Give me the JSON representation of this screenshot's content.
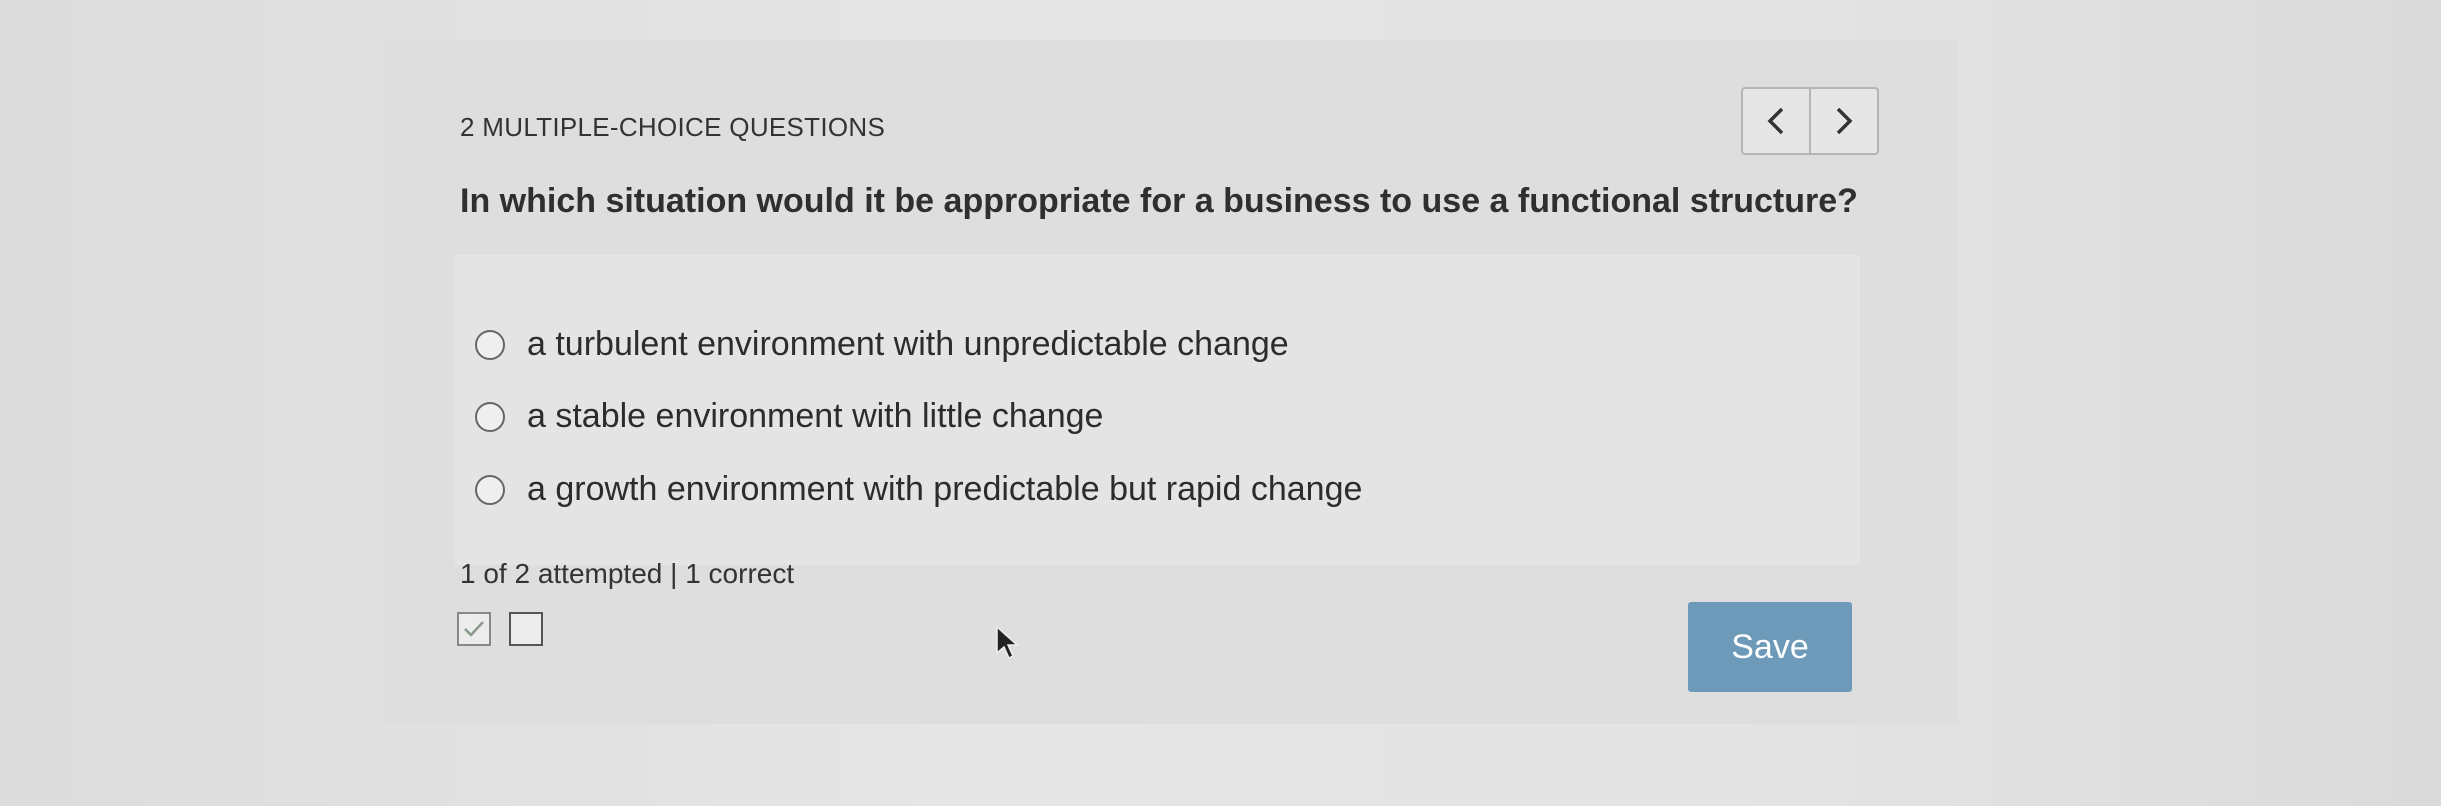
{
  "header": {
    "section_title": "2 MULTIPLE-CHOICE QUESTIONS",
    "prev_icon": "chevron-left-icon",
    "next_icon": "chevron-right-icon"
  },
  "question": {
    "text": "In which situation would it be appropriate for a business to use a functional structure?",
    "options": [
      {
        "label": "a turbulent environment with unpredictable change",
        "selected": false
      },
      {
        "label": "a stable environment with little change",
        "selected": false
      },
      {
        "label": "a growth environment with predictable but rapid change",
        "selected": false
      }
    ]
  },
  "footer": {
    "status": "1 of 2 attempted | 1 correct",
    "question_status": [
      "correct",
      "unanswered"
    ],
    "save_label": "Save"
  },
  "colors": {
    "save_button": "#6d9ab8",
    "card": "#dedede",
    "options_panel": "#e4e4e4"
  }
}
